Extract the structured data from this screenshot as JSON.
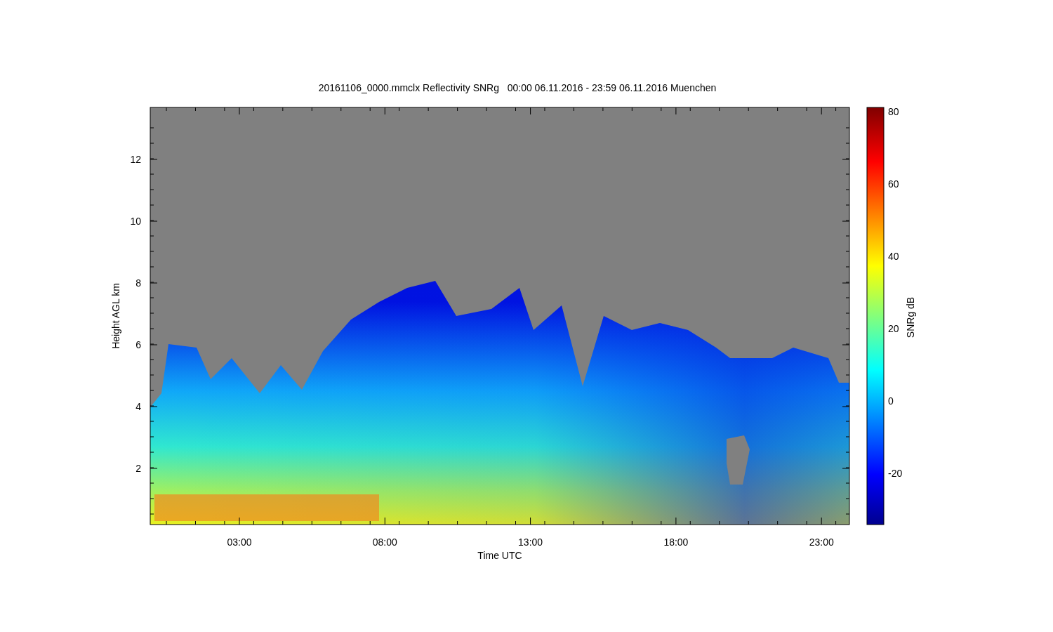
{
  "title": "20161106_0000.mmclx Reflectivity SNRg   00:00 06.11.2016 - 23:59 06.11.2016 Muenchen",
  "y_axis": {
    "label": "Height AGL km",
    "ticks": [
      "12",
      "10",
      "8",
      "6",
      "4",
      "2"
    ]
  },
  "x_axis": {
    "label": "Time UTC",
    "ticks": [
      "03:00",
      "08:00",
      "13:00",
      "18:00",
      "23:00"
    ]
  },
  "colorbar": {
    "label": "SNRg dB",
    "ticks": [
      "80",
      "60",
      "40",
      "20",
      "0",
      "-20"
    ]
  }
}
